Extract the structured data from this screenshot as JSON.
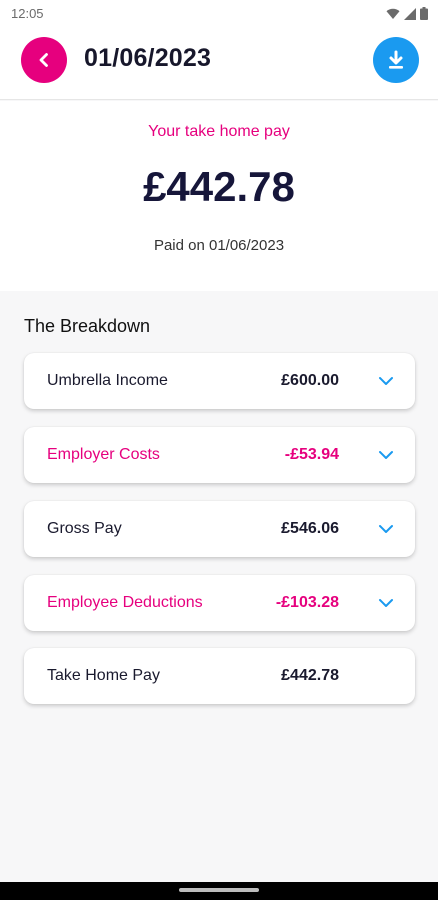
{
  "status_bar": {
    "time": "12:05",
    "icons": [
      "wifi-icon",
      "signal-icon",
      "battery-icon"
    ]
  },
  "header": {
    "title": "01/06/2023",
    "back_icon": "chevron-left-icon",
    "download_icon": "download-icon"
  },
  "summary": {
    "label": "Your take home pay",
    "amount": "£442.78",
    "paid_on": "Paid on 01/06/2023"
  },
  "breakdown": {
    "title": "The Breakdown",
    "items": [
      {
        "label": "Umbrella Income",
        "value": "£600.00",
        "negative": false,
        "expandable": true
      },
      {
        "label": "Employer Costs",
        "value": "-£53.94",
        "negative": true,
        "expandable": true
      },
      {
        "label": "Gross Pay",
        "value": "£546.06",
        "negative": false,
        "expandable": true
      },
      {
        "label": "Employee Deductions",
        "value": "-£103.28",
        "negative": true,
        "expandable": true
      },
      {
        "label": "Take Home Pay",
        "value": "£442.78",
        "negative": false,
        "expandable": false
      }
    ]
  },
  "colors": {
    "accent_pink": "#e6007e",
    "accent_blue": "#1a9af0",
    "text_dark": "#16163a"
  }
}
